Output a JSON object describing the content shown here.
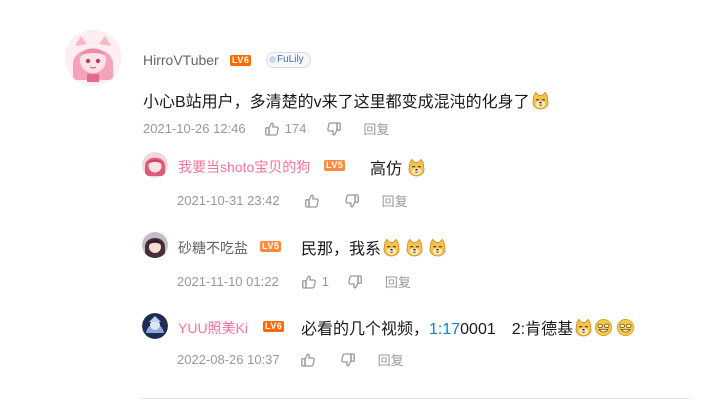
{
  "comments": [
    {
      "username": "HirroVTuber",
      "level": "LV6",
      "fan_badge": "FuLily",
      "text": "小心B站用户，多清楚的v来了这里都变成混沌的化身了",
      "date": "2021-10-26 12:46",
      "likes": "174",
      "reply_label": "回复",
      "emojis": [
        "doge-emoji"
      ]
    },
    {
      "username": "我要当shoto宝贝的狗",
      "level": "LV5",
      "text": "高仿",
      "date": "2021-10-31 23:42",
      "likes": "",
      "reply_label": "回复",
      "emojis": [
        "doge-emoji"
      ]
    },
    {
      "username": "砂糖不吃盐",
      "level": "LV5",
      "text": "民那，我系",
      "date": "2021-11-10 01:22",
      "likes": "1",
      "reply_label": "回复",
      "emojis": [
        "doge-emoji",
        "doge-emoji",
        "doge-emoji"
      ]
    },
    {
      "username": "YUU照美Ki",
      "level": "LV6",
      "text_before": "必看的几个视频，",
      "text_link": "1:17",
      "text_after": "0001　2:肯德基",
      "date": "2022-08-26 10:37",
      "likes": "",
      "reply_label": "回复",
      "emojis": [
        "doge-emoji",
        "grin-emoji",
        "grin-emoji"
      ]
    }
  ],
  "colors": {
    "username_vip": "#fb7299",
    "username_blue": "#00aeec",
    "text": "#18191c",
    "meta": "#9499a0",
    "link": "#008ac5",
    "level_badge": "#ff6a00"
  }
}
